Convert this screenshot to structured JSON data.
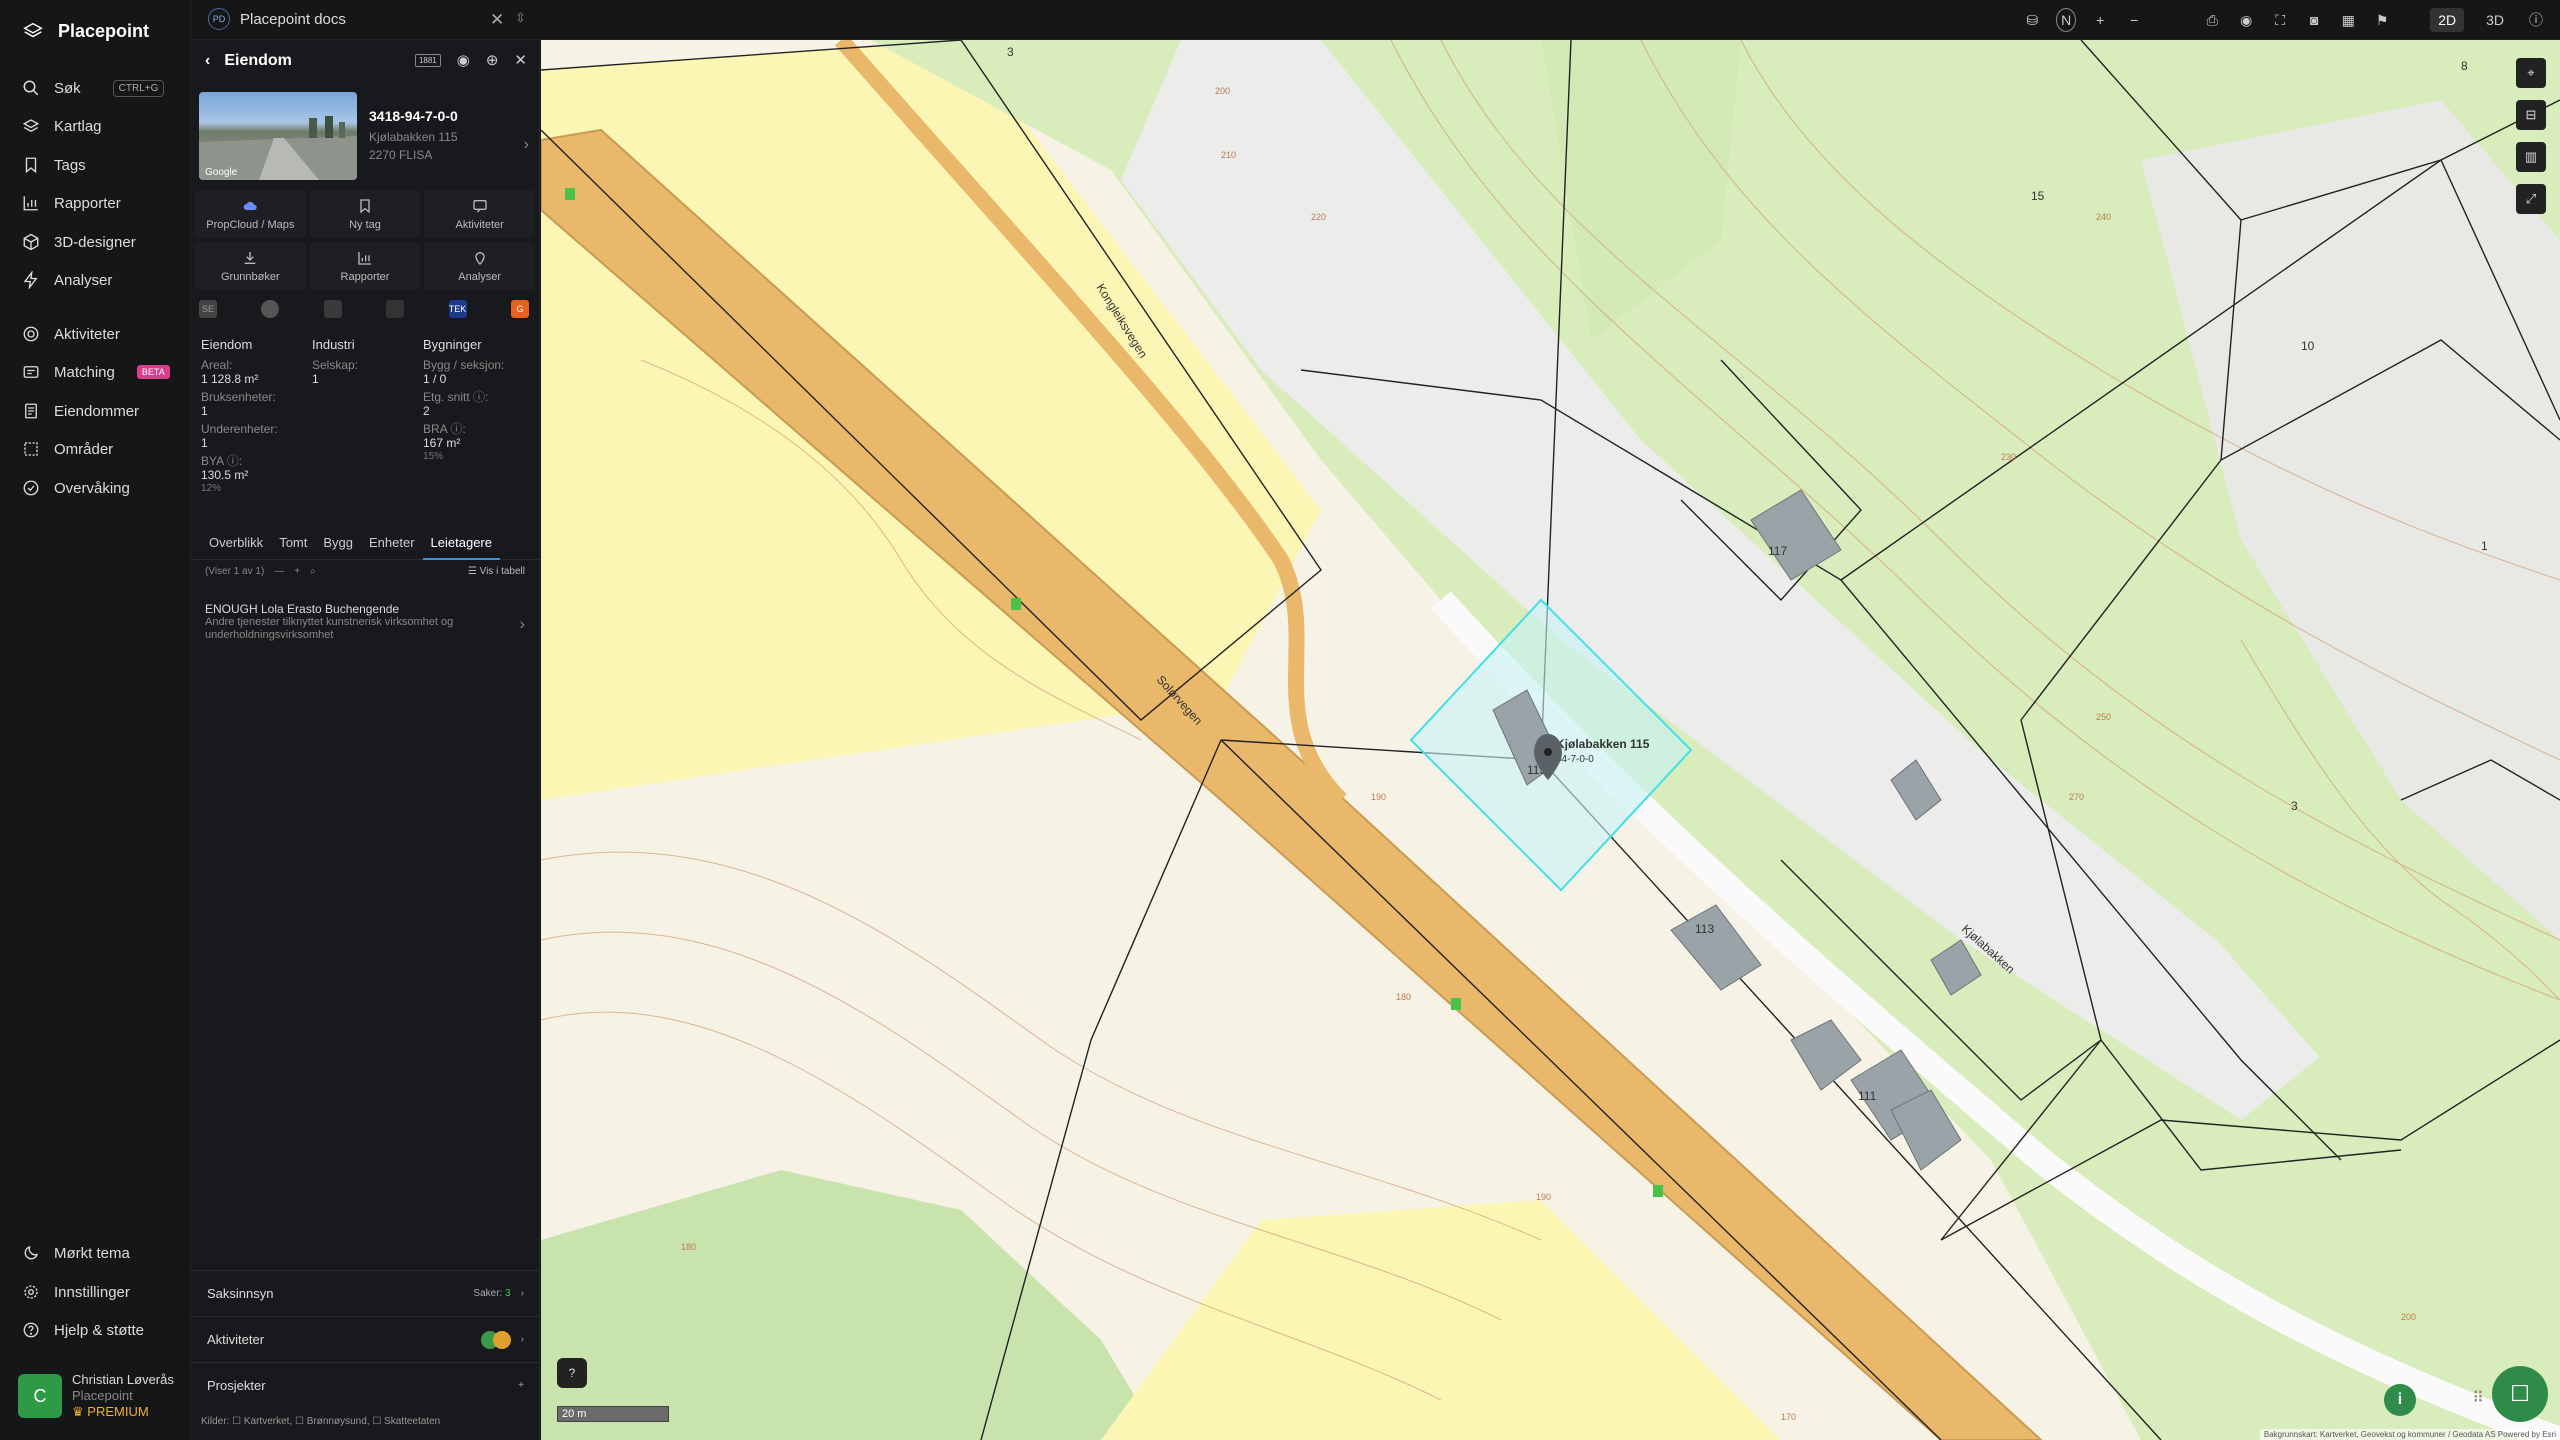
{
  "app": {
    "name": "Placepoint"
  },
  "nav": {
    "search": "Søk",
    "search_shortcut": "CTRL+G",
    "layers": "Kartlag",
    "tags": "Tags",
    "reports": "Rapporter",
    "designer": "3D-designer",
    "analyses": "Analyser",
    "activities": "Aktiviteter",
    "matching": "Matching",
    "beta": "BETA",
    "properties": "Eiendommer",
    "areas": "Områder",
    "monitoring": "Overvåking",
    "dark_theme": "Mørkt tema",
    "settings": "Innstillinger",
    "help": "Hjelp & støtte"
  },
  "user": {
    "initial": "C",
    "name": "Christian Løverås",
    "org": "Placepoint",
    "plan": "PREMIUM"
  },
  "doc_tab": {
    "initials": "PD",
    "title": "Placepoint docs"
  },
  "top_tools": {
    "compass": "N",
    "mode_2d": "2D",
    "mode_3d": "3D"
  },
  "panel": {
    "title": "Eiendom",
    "badge": "1881",
    "photo_label": "Google",
    "property_id": "3418-94-7-0-0",
    "address_line1": "Kjølabakken 115",
    "address_line2": "2270 FLISA",
    "actions": [
      "PropCloud / Maps",
      "Ny tag",
      "Aktiviteter",
      "Grunnbøker",
      "Rapporter",
      "Analyser"
    ],
    "logos": [
      "SE",
      "",
      "",
      "",
      "TEK",
      "G"
    ],
    "stats": {
      "col1": {
        "heading": "Eiendom",
        "areal_label": "Areal:",
        "areal_value": "1 128.8 m²",
        "bruk_label": "Bruksenheter:",
        "bruk_value": "1",
        "under_label": "Underenheter:",
        "under_value": "1",
        "bya_label": "BYA ⓘ:",
        "bya_value": "130.5 m²",
        "bya_pct": "12%"
      },
      "col2": {
        "heading": "Industri",
        "selskap_label": "Selskap:",
        "selskap_value": "1"
      },
      "col3": {
        "heading": "Bygninger",
        "bygg_label": "Bygg / seksjon:",
        "bygg_value": "1 / 0",
        "etg_label": "Etg. snitt ⓘ:",
        "etg_value": "2",
        "bra_label": "BRA ⓘ:",
        "bra_value": "167 m²",
        "bra_pct": "15%"
      }
    },
    "tabs": [
      "Overblikk",
      "Tomt",
      "Bygg",
      "Enheter",
      "Leietagere"
    ],
    "active_tab": "Leietagere",
    "list_count": "(Viser 1 av 1)",
    "table_view": "Vis i tabell",
    "result": {
      "title": "ENOUGH Lola Erasto Buchengende",
      "desc": "Andre tjenester tilknyttet kunstnerisk virksomhet og underholdningsvirksomhet"
    },
    "sections": {
      "case": "Saksinnsyn",
      "case_count_label": "Saker:",
      "case_count": "3",
      "activities": "Aktiviteter",
      "projects": "Prosjekter"
    },
    "sources": "Kilder: ☐ Kartverket, ☐ Brønnøysund, ☐ Skatteetaten"
  },
  "map": {
    "colors": {
      "yellow": "#fbf6b4",
      "green": "#d8ecbc",
      "road": "#e9b86a",
      "selection": "#40e0e8",
      "building": "#9aa3a8"
    },
    "road_labels": [
      "Kongleiksvegen",
      "Solørvegen",
      "Kjølabakken"
    ],
    "building_numbers": [
      "117",
      "115",
      "113",
      "111",
      "10",
      "15",
      "3",
      "1",
      "8",
      "3"
    ],
    "selected_label": "Kjølabakken 115",
    "selected_sub": "94-7-0-0",
    "contours": [
      "200",
      "210",
      "220",
      "190",
      "180",
      "250",
      "270",
      "230",
      "240",
      "200",
      "190",
      "180",
      "170"
    ],
    "scale": "20 m",
    "attribution": "Bakgrunnskart: Kartverket, Geovekst og kommuner / Geodata AS Powered by Esri"
  }
}
